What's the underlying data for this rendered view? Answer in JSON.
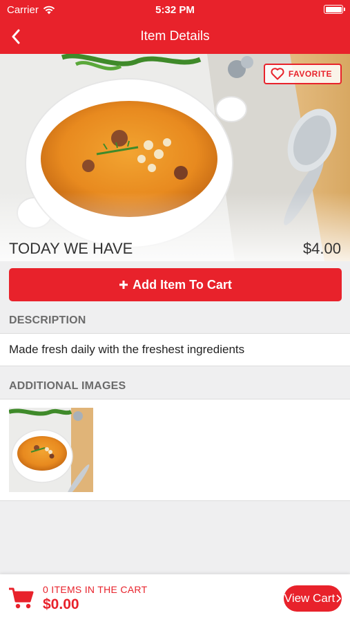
{
  "status_bar": {
    "carrier": "Carrier",
    "time": "5:32 PM"
  },
  "nav": {
    "title": "Item Details",
    "back_icon": "chevron-left-icon"
  },
  "hero": {
    "favorite_label": "FAVORITE"
  },
  "item": {
    "name": "TODAY WE HAVE",
    "price": "$4.00"
  },
  "add_to_cart": {
    "label": "Add Item To Cart",
    "icon": "plus-icon"
  },
  "description": {
    "header": "DESCRIPTION",
    "text": "Made fresh daily with the freshest ingredients"
  },
  "additional_images": {
    "header": "ADDITIONAL IMAGES"
  },
  "cart": {
    "count_text": "0 ITEMS IN THE CART",
    "total": "$0.00",
    "view_label": "View Cart"
  },
  "colors": {
    "brand_red": "#e8222b"
  }
}
